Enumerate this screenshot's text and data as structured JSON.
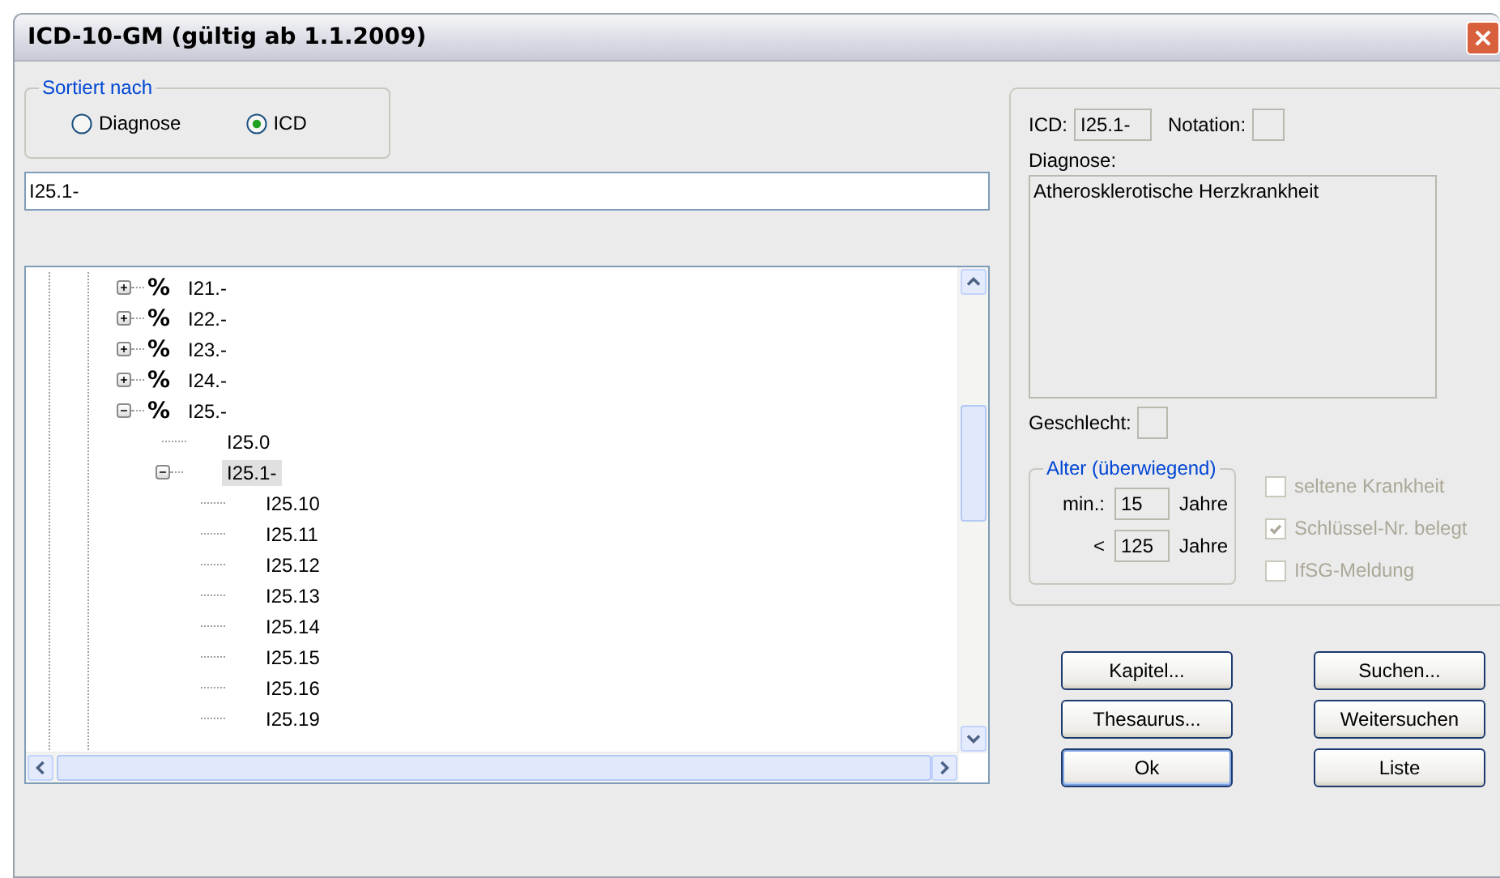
{
  "window": {
    "title": "ICD-10-GM (gültig ab 1.1.2009)"
  },
  "sort": {
    "legend": "Sortiert nach",
    "options": [
      {
        "label": "Diagnose",
        "selected": false
      },
      {
        "label": "ICD",
        "selected": true
      }
    ]
  },
  "search": {
    "value": "I25.1-"
  },
  "tree": {
    "items": [
      {
        "kind": "group",
        "marker": "%",
        "label": "I21.-",
        "expanded": false,
        "selected": false
      },
      {
        "kind": "group",
        "marker": "%",
        "label": "I22.-",
        "expanded": false,
        "selected": false
      },
      {
        "kind": "group",
        "marker": "%",
        "label": "I23.-",
        "expanded": false,
        "selected": false
      },
      {
        "kind": "group",
        "marker": "%",
        "label": "I24.-",
        "expanded": false,
        "selected": false
      },
      {
        "kind": "group",
        "marker": "%",
        "label": "I25.-",
        "expanded": true,
        "selected": false,
        "children": [
          {
            "kind": "leaf",
            "label": "I25.0",
            "selected": false
          },
          {
            "kind": "group",
            "label": "I25.1-",
            "expanded": true,
            "selected": true,
            "children": [
              {
                "kind": "leaf",
                "label": "I25.10",
                "selected": false
              },
              {
                "kind": "leaf",
                "label": "I25.11",
                "selected": false
              },
              {
                "kind": "leaf",
                "label": "I25.12",
                "selected": false
              },
              {
                "kind": "leaf",
                "label": "I25.13",
                "selected": false
              },
              {
                "kind": "leaf",
                "label": "I25.14",
                "selected": false
              },
              {
                "kind": "leaf",
                "label": "I25.15",
                "selected": false
              },
              {
                "kind": "leaf",
                "label": "I25.16",
                "selected": false
              },
              {
                "kind": "leaf",
                "label": "I25.19",
                "selected": false
              }
            ]
          }
        ]
      }
    ]
  },
  "details": {
    "icd_label": "ICD:",
    "icd_value": "I25.1-",
    "notation_label": "Notation:",
    "diagnosis_label": "Diagnose:",
    "diagnosis_value": "Atherosklerotische Herzkrankheit",
    "sex_label": "Geschlecht:",
    "age": {
      "legend": "Alter (überwiegend)",
      "rows": [
        {
          "label": "min.:",
          "value": "15",
          "unit": "Jahre"
        },
        {
          "label": "<",
          "value": "125",
          "unit": "Jahre"
        }
      ]
    },
    "flags": [
      {
        "label": "seltene Krankheit",
        "checked": false,
        "disabled": true
      },
      {
        "label": "Schlüssel-Nr. belegt",
        "checked": true,
        "disabled": true
      },
      {
        "label": "IfSG-Meldung",
        "checked": false,
        "disabled": true
      }
    ]
  },
  "buttons": [
    {
      "label": "Kapitel...",
      "default": false
    },
    {
      "label": "Suchen...",
      "default": false
    },
    {
      "label": "Thesaurus...",
      "default": false
    },
    {
      "label": "Weitersuchen",
      "default": false
    },
    {
      "label": "Ok",
      "default": true
    },
    {
      "label": "Liste",
      "default": false
    }
  ]
}
